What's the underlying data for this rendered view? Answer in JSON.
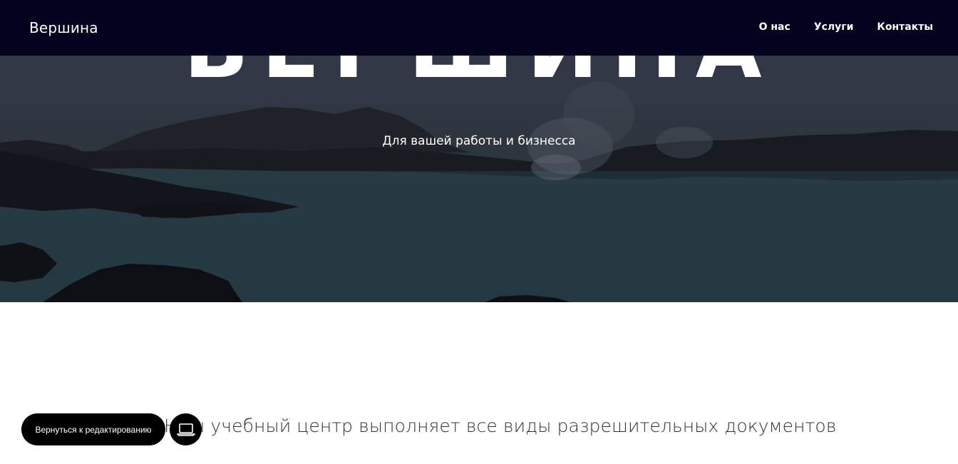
{
  "header": {
    "logo": "Вершина",
    "nav": [
      {
        "label": "О нас"
      },
      {
        "label": "Услуги"
      },
      {
        "label": "Контакты"
      }
    ]
  },
  "hero": {
    "title": "ВЕРШИНА",
    "subtitle": "Для вашей работы и бизнесса"
  },
  "content": {
    "text": "Наш учебный центр выполняет все виды разрешительных документов"
  },
  "editor": {
    "back_label": "Вернуться к редактированию",
    "device_icon": "laptop-icon"
  },
  "colors": {
    "header_bg": "#03021f",
    "button_bg": "#000000"
  }
}
